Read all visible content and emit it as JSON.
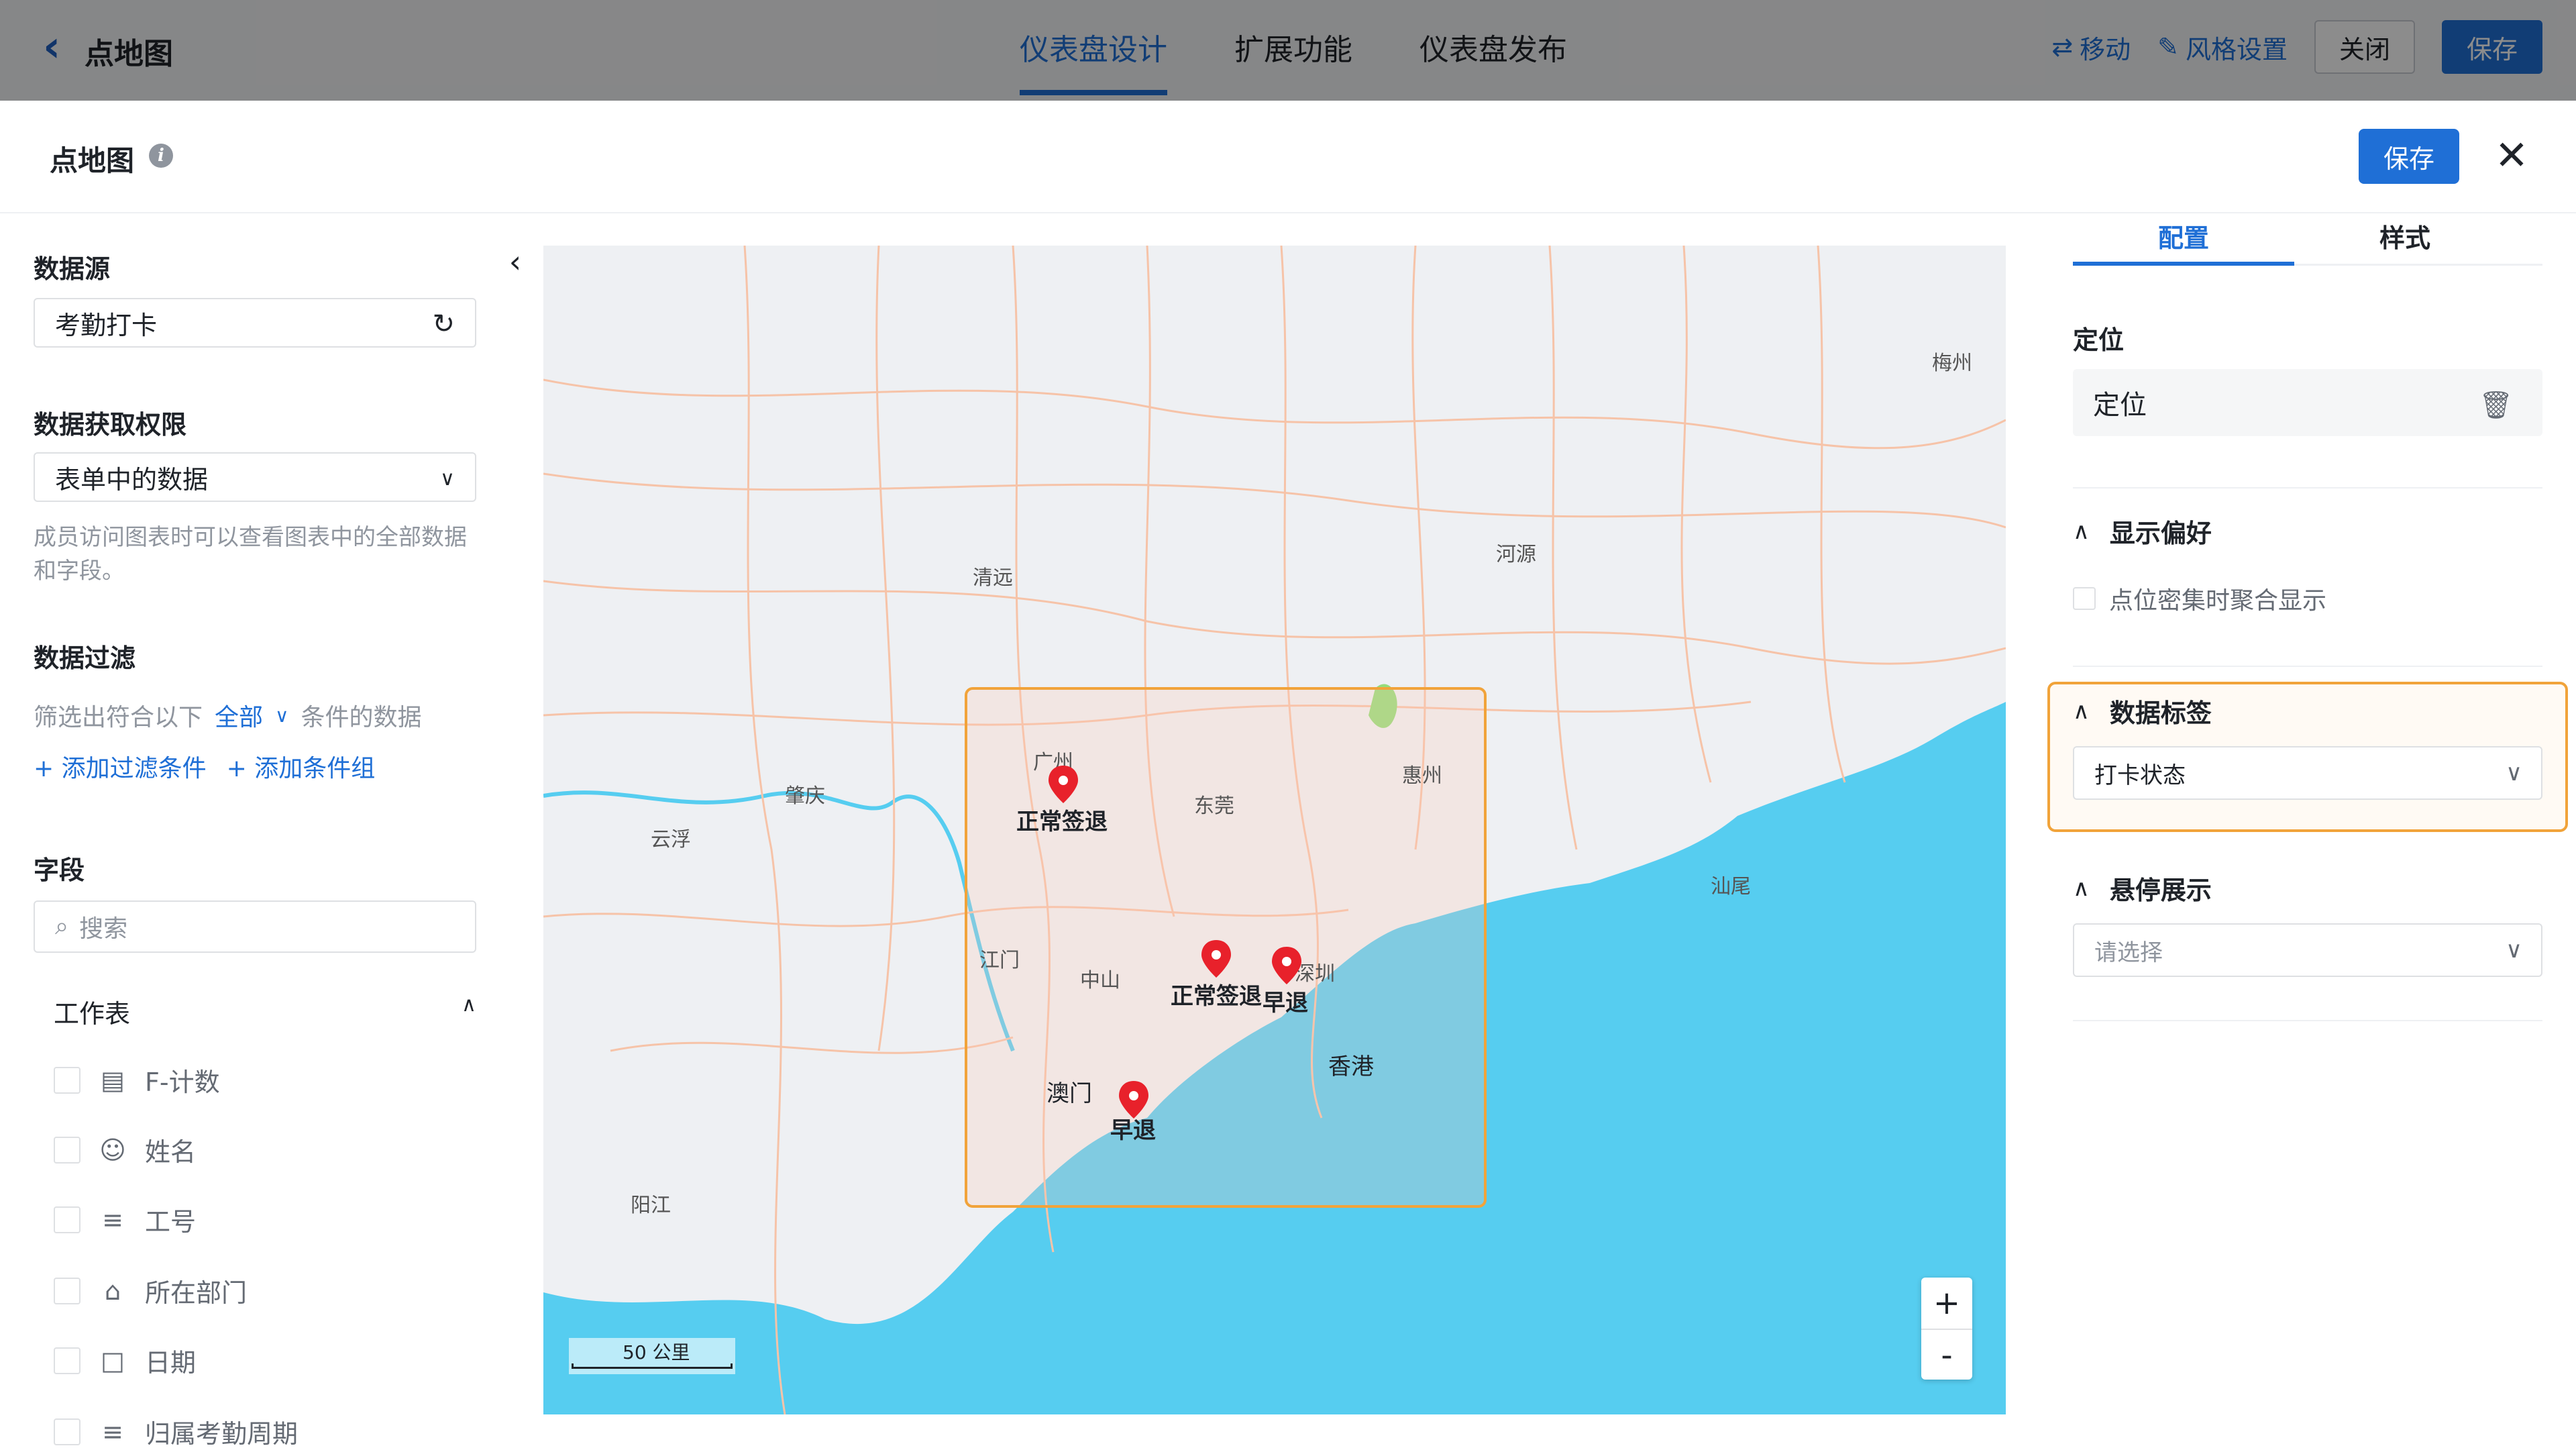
{
  "topbar": {
    "title": "点地图",
    "nav": [
      "仪表盘设计",
      "扩展功能",
      "仪表盘发布"
    ],
    "move_label": "移动",
    "style_label": "风格设置",
    "close_label": "关闭",
    "save_label": "保存"
  },
  "modal": {
    "title": "点地图",
    "save_label": "保存"
  },
  "left": {
    "datasource_title": "数据源",
    "datasource_value": "考勤打卡",
    "permission_title": "数据获取权限",
    "permission_value": "表单中的数据",
    "permission_hint": "成员访问图表时可以查看图表中的全部数据和字段。",
    "filter_title": "数据过滤",
    "filter_prefix": "筛选出符合以下",
    "filter_mode": "全部",
    "filter_suffix": "条件的数据",
    "add_filter": "添加过滤条件",
    "add_group": "添加条件组",
    "fields_title": "字段",
    "search_placeholder": "搜索",
    "group_name": "工作表",
    "fields": [
      {
        "label": "F-计数",
        "icon": "count-icon"
      },
      {
        "label": "姓名",
        "icon": "person-icon"
      },
      {
        "label": "工号",
        "icon": "text-icon"
      },
      {
        "label": "所在部门",
        "icon": "department-icon"
      },
      {
        "label": "日期",
        "icon": "calendar-icon"
      },
      {
        "label": "归属考勤周期",
        "icon": "text-icon"
      }
    ]
  },
  "map": {
    "cities": [
      "梅州",
      "河源",
      "清远",
      "广州",
      "东莞",
      "惠州",
      "肇庆",
      "云浮",
      "汕尾",
      "江门",
      "中山",
      "深圳",
      "香港",
      "澳门",
      "阳江"
    ],
    "markers": [
      "正常签退",
      "正常签退",
      "早退",
      "早退"
    ],
    "scale_label": "50 公里",
    "zoom_in": "+",
    "zoom_out": "-"
  },
  "right": {
    "tabs": [
      "配置",
      "样式"
    ],
    "position_title": "定位",
    "position_value": "定位",
    "display_title": "显示偏好",
    "cluster_label": "点位密集时聚合显示",
    "label_title": "数据标签",
    "label_value": "打卡状态",
    "hover_title": "悬停展示",
    "hover_placeholder": "请选择"
  },
  "colors": {
    "accent": "#1f6fd6",
    "sea": "#56cdf0",
    "highlight": "#f1a33a",
    "marker": "#e8212b"
  }
}
